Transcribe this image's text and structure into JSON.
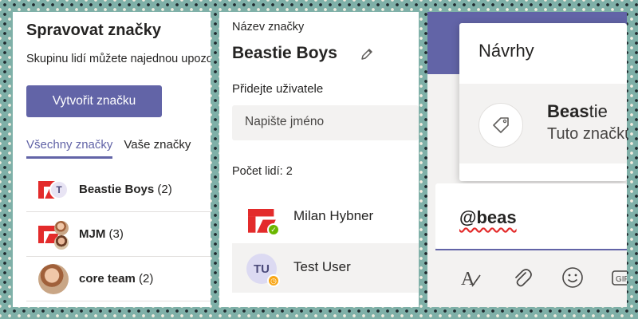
{
  "manage_panel": {
    "title": "Spravovat značky",
    "description": "Skupinu lidí můžete najednou upozornit",
    "create_button": "Vytvořit značku",
    "tabs": [
      {
        "label": "Všechny značky",
        "active": true
      },
      {
        "label": "Vaše značky",
        "active": false
      }
    ],
    "tags": [
      {
        "name": "Beastie Boys",
        "count": "(2)"
      },
      {
        "name": "MJM",
        "count": "(3)"
      },
      {
        "name": "core team",
        "count": "(2)"
      }
    ]
  },
  "tag_detail_panel": {
    "name_label": "Název značky",
    "tag_name": "Beastie Boys",
    "add_users_label": "Přidejte uživatele",
    "name_placeholder": "Napište jméno",
    "people_count_label": "Počet lidí: 2",
    "members": [
      {
        "name": "Milan Hybner",
        "initials": "",
        "status": "available"
      },
      {
        "name": "Test User",
        "initials": "TU",
        "status": "away"
      }
    ]
  },
  "compose_panel": {
    "suggestions_heading": "Návrhy",
    "suggestion": {
      "name_bold": "Beas",
      "name_rest": "tie",
      "subtitle": "Tuto značku"
    },
    "compose_text": "@beas",
    "toolbar": [
      "format-icon",
      "attach-icon",
      "emoji-icon",
      "gif-icon"
    ]
  },
  "colors": {
    "accent": "#6264a7",
    "brand_red": "#e32b2b",
    "available": "#6bb700",
    "away": "#f8a616"
  }
}
